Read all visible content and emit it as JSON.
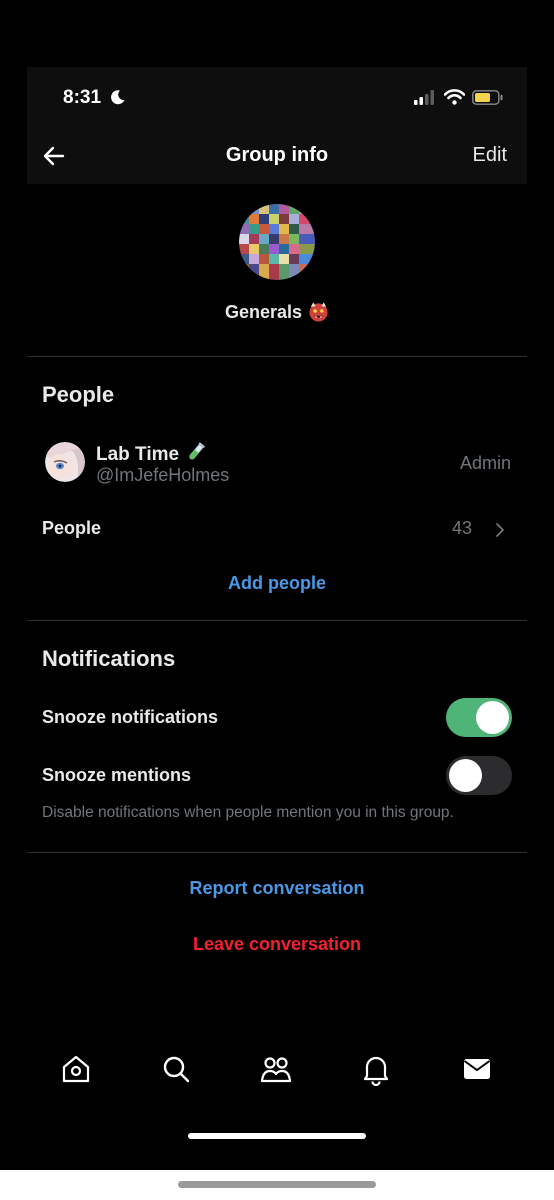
{
  "status_bar": {
    "time": "8:31"
  },
  "nav": {
    "title": "Group info",
    "edit_label": "Edit",
    "back_icon": "arrow-left-icon"
  },
  "group": {
    "name": "Generals",
    "emoji": "ogre-emoji"
  },
  "people_section": {
    "title": "People",
    "admin": {
      "name": "Lab Time",
      "emoji": "test-tube-emoji",
      "handle": "@ImJefeHolmes",
      "role": "Admin"
    },
    "people_row": {
      "label": "People",
      "count": "43"
    },
    "add_people_label": "Add people"
  },
  "notifications_section": {
    "title": "Notifications",
    "snooze_notifications": {
      "label": "Snooze notifications",
      "enabled": true
    },
    "snooze_mentions": {
      "label": "Snooze mentions",
      "enabled": false
    },
    "help_text": "Disable notifications when people mention you in this group."
  },
  "actions": {
    "report_label": "Report conversation",
    "leave_label": "Leave conversation"
  },
  "tab_bar": {
    "tabs": [
      "home-icon",
      "search-icon",
      "communities-icon",
      "notifications-bell-icon",
      "messages-envelope-icon"
    ]
  },
  "colors": {
    "background": "#000000",
    "link_blue": "#4a99e9",
    "danger_red": "#f4212e",
    "toggle_green": "#4fb477",
    "secondary_text": "#71767b"
  }
}
